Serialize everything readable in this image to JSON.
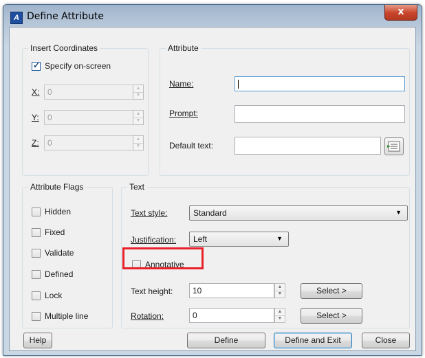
{
  "window": {
    "title": "Define Attribute",
    "close_label": "x"
  },
  "insert_coordinates": {
    "label": "Insert Coordinates",
    "specify_onscreen": {
      "label": "Specify on-screen",
      "checked": true
    },
    "x": {
      "label": "X:",
      "value": "0"
    },
    "y": {
      "label": "Y:",
      "value": "0"
    },
    "z": {
      "label": "Z:",
      "value": "0"
    }
  },
  "attribute": {
    "label": "Attribute",
    "name": {
      "label": "Name:",
      "value": ""
    },
    "prompt": {
      "label": "Prompt:",
      "value": ""
    },
    "default_text": {
      "label": "Default text:",
      "value": ""
    }
  },
  "attribute_flags": {
    "label": "Attribute Flags",
    "items": [
      {
        "label": "Hidden",
        "checked": false
      },
      {
        "label": "Fixed",
        "checked": false
      },
      {
        "label": "Validate",
        "checked": false
      },
      {
        "label": "Defined",
        "checked": false
      },
      {
        "label": "Lock",
        "checked": false
      },
      {
        "label": "Multiple line",
        "checked": false
      }
    ]
  },
  "text": {
    "label": "Text",
    "text_style": {
      "label": "Text style:",
      "value": "Standard"
    },
    "justification": {
      "label": "Justification:",
      "value": "Left"
    },
    "annotative": {
      "label": "Annotative",
      "checked": false
    },
    "text_height": {
      "label": "Text height:",
      "value": "10",
      "select_label": "Select >"
    },
    "rotation": {
      "label": "Rotation:",
      "value": "0",
      "select_label": "Select >"
    }
  },
  "footer": {
    "help": "Help",
    "define": "Define",
    "define_and_exit": "Define and Exit",
    "close": "Close"
  },
  "colors": {
    "highlight": "#e8202a",
    "accent": "#3c7fb1"
  }
}
